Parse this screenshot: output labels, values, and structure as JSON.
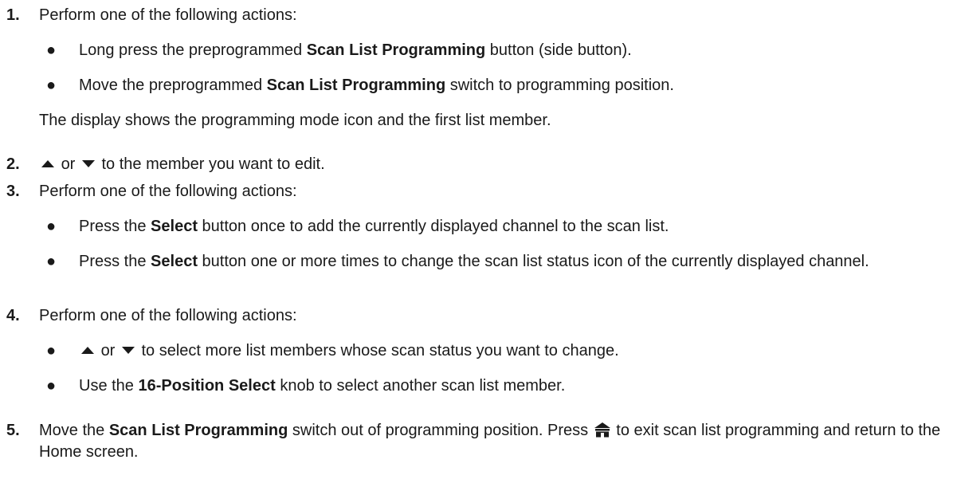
{
  "steps": [
    {
      "number": "1.",
      "text": "Perform one of the following actions:",
      "bullets": [
        {
          "pre": "Long press the preprogrammed ",
          "bold": "Scan List Programming",
          "post": " button (side button)."
        },
        {
          "pre": "Move the preprogrammed ",
          "bold": "Scan List Programming",
          "post": " switch to programming position."
        }
      ],
      "note": "The display shows the programming mode icon and the first list member."
    },
    {
      "number": "2.",
      "or": "or",
      "text": "to the member you want to edit."
    },
    {
      "number": "3.",
      "text": "Perform one of the following actions:",
      "bullets": [
        {
          "pre": "Press the ",
          "bold": "Select",
          "post": " button once to add the currently displayed channel to the scan list."
        },
        {
          "pre": "Press the ",
          "bold": "Select",
          "post": " button one or more times to change the scan list status icon of the currently displayed channel."
        }
      ]
    },
    {
      "number": "4.",
      "text": "Perform one of the following actions:",
      "bullets": [
        {
          "or": "or",
          "post": "to select more list members whose scan status you want to change."
        },
        {
          "pre": "Use the ",
          "bold": "16-Position Select",
          "post": " knob to select another scan list member."
        }
      ]
    },
    {
      "number": "5.",
      "pre": "Move the ",
      "bold": "Scan List Programming",
      "mid": " switch out of programming position. Press ",
      "post": " to exit scan list programming and return to the Home screen."
    }
  ],
  "bullet_char": "●",
  "icons": {
    "up": "up-arrow-icon",
    "down": "down-arrow-icon",
    "home": "home-icon"
  }
}
